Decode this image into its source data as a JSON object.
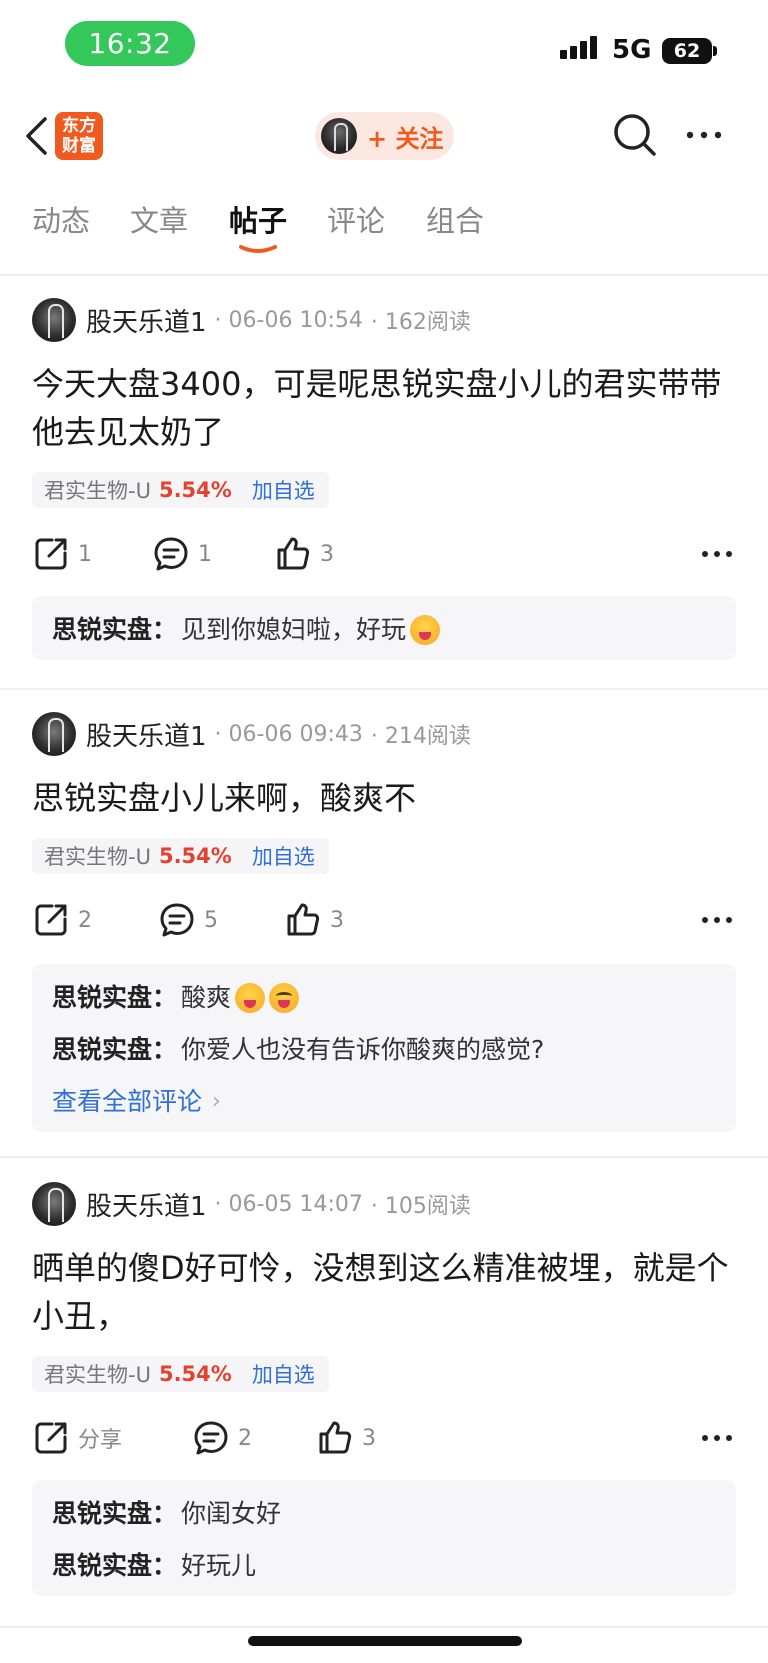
{
  "status_bar": {
    "time": "16:32",
    "network": "5G",
    "battery": "62"
  },
  "header": {
    "logo_line1": "东方",
    "logo_line2": "财富",
    "follow_label": "+ 关注"
  },
  "tabs": [
    {
      "label": "动态"
    },
    {
      "label": "文章"
    },
    {
      "label": "帖子"
    },
    {
      "label": "评论"
    },
    {
      "label": "组合"
    }
  ],
  "colors": {
    "accent": "#f05a1e",
    "up": "#e4422e",
    "link": "#2f6fd6",
    "time_pill": "#34c759"
  },
  "posts": [
    {
      "author": "股天乐道1",
      "time": "· 06-06 10:54",
      "reads": "· 162阅读",
      "content": "今天大盘3400，可是呢思锐实盘小儿的君实带带他去见太奶了",
      "stock": {
        "name": "君实生物-U",
        "change": "5.54%",
        "watchlist": "加自选"
      },
      "share": "1",
      "comments_count": "1",
      "likes": "3",
      "comments": [
        {
          "user": "思锐实盘",
          "text": "见到你媳妇啦，好玩"
        }
      ]
    },
    {
      "author": "股天乐道1",
      "time": "· 06-06 09:43",
      "reads": "· 214阅读",
      "content": "思锐实盘小儿来啊，酸爽不",
      "stock": {
        "name": "君实生物-U",
        "change": "5.54%",
        "watchlist": "加自选"
      },
      "share": "2",
      "comments_count": "5",
      "likes": "3",
      "comments": [
        {
          "user": "思锐实盘",
          "text": "酸爽"
        },
        {
          "user": "思锐实盘",
          "text": "你爱人也没有告诉你酸爽的感觉?"
        }
      ],
      "view_all": "查看全部评论"
    },
    {
      "author": "股天乐道1",
      "time": "· 06-05 14:07",
      "reads": "· 105阅读",
      "content": "晒单的傻D好可怜，没想到这么精准被埋，就是个小丑，",
      "stock": {
        "name": "君实生物-U",
        "change": "5.54%",
        "watchlist": "加自选"
      },
      "share": "分享",
      "comments_count": "2",
      "likes": "3",
      "comments": [
        {
          "user": "思锐实盘",
          "text": "你闺女好"
        },
        {
          "user": "思锐实盘",
          "text": "好玩儿"
        }
      ]
    }
  ]
}
